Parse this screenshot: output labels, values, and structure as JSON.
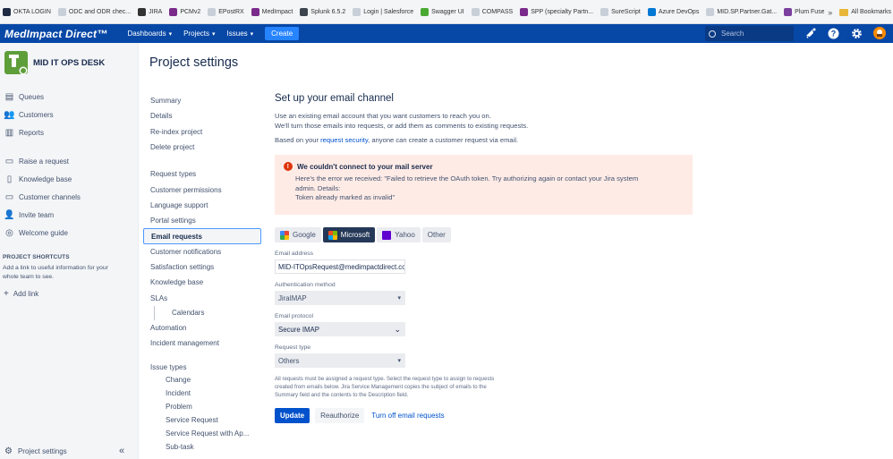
{
  "bookmarks": [
    {
      "label": "OKTA LOGIN",
      "color": "#1f2a44"
    },
    {
      "label": "ODC and ODR chec...",
      "color": "#c9cfd8"
    },
    {
      "label": "JIRA",
      "color": "#333333"
    },
    {
      "label": "PCMv2",
      "color": "#7a2a8a"
    },
    {
      "label": "EPostRX",
      "color": "#c9cfd8"
    },
    {
      "label": "MedImpact",
      "color": "#7a2a8a"
    },
    {
      "label": "Splunk 6.5.2",
      "color": "#3c444d"
    },
    {
      "label": "Login | Salesforce",
      "color": "#c9cfd8"
    },
    {
      "label": "Swagger UI",
      "color": "#49a832"
    },
    {
      "label": "COMPASS",
      "color": "#c9cfd8"
    },
    {
      "label": "SPP (specialty Partn...",
      "color": "#7a2a8a"
    },
    {
      "label": "SureScript",
      "color": "#c9cfd8"
    },
    {
      "label": "Azure DevOps",
      "color": "#0078d4"
    },
    {
      "label": "MID.SP.Partner.Gat...",
      "color": "#c9cfd8"
    },
    {
      "label": "Plum Fuse :: Login",
      "color": "#7b3f9e"
    }
  ],
  "bookmarks_more": "»",
  "bookmarks_all": "All Bookmarks",
  "topnav": {
    "logo": "MedImpact Direct™",
    "dashboards": "Dashboards",
    "projects": "Projects",
    "issues": "Issues",
    "create": "Create",
    "search_placeholder": "Search"
  },
  "sidebar": {
    "project_name": "MID IT OPS DESK",
    "group1": [
      {
        "label": "Queues",
        "icon": "queues-icon"
      },
      {
        "label": "Customers",
        "icon": "customers-icon"
      },
      {
        "label": "Reports",
        "icon": "reports-icon"
      }
    ],
    "group2": [
      {
        "label": "Raise a request",
        "icon": "raise-request-icon"
      },
      {
        "label": "Knowledge base",
        "icon": "knowledge-base-icon"
      },
      {
        "label": "Customer channels",
        "icon": "customer-channels-icon"
      },
      {
        "label": "Invite team",
        "icon": "invite-team-icon"
      },
      {
        "label": "Welcome guide",
        "icon": "welcome-guide-icon"
      }
    ],
    "shortcuts_heading": "PROJECT SHORTCUTS",
    "shortcuts_text": "Add a link to useful information for your whole team to see.",
    "add_link": "Add link",
    "bottom": "Project settings",
    "collapse": "«"
  },
  "page_title": "Project settings",
  "settings_nav": {
    "summary": "Summary",
    "details": "Details",
    "reindex": "Re-index project",
    "delete": "Delete project",
    "request_types": "Request types",
    "customer_permissions": "Customer permissions",
    "language_support": "Language support",
    "portal_settings": "Portal settings",
    "email_requests": "Email requests",
    "customer_notifications": "Customer notifications",
    "satisfaction_settings": "Satisfaction settings",
    "knowledge_base": "Knowledge base",
    "slas": "SLAs",
    "calendars": "Calendars",
    "automation": "Automation",
    "incident_management": "Incident management",
    "issue_types": "Issue types",
    "change": "Change",
    "incident": "Incident",
    "problem": "Problem",
    "service_request": "Service Request",
    "service_request_ap": "Service Request with Ap...",
    "subtask": "Sub-task"
  },
  "content": {
    "heading": "Set up your email channel",
    "intro1": "Use an existing email account that you want customers to reach you on.",
    "intro2": "We'll turn those emails into requests, or add them as comments to existing requests.",
    "based_pre": "Based on your ",
    "based_link": "request security",
    "based_post": ", anyone can create a customer request via email.",
    "error_title": "We couldn't connect to your mail server",
    "error_line1": "Here's the error we received: \"Failed to retrieve the OAuth token. Try authorizing again or contact your Jira system",
    "error_line2": "admin. Details:",
    "error_line3": "Token already marked as invalid\"",
    "providers": {
      "google": "Google",
      "microsoft": "Microsoft",
      "yahoo": "Yahoo",
      "other": "Other"
    },
    "email_label": "Email address",
    "email_value": "MID-ITOpsRequest@medimpactdirect.com",
    "auth_label": "Authentication method",
    "auth_value": "JiraIMAP",
    "protocol_label": "Email protocol",
    "protocol_value": "Secure IMAP",
    "reqtype_label": "Request type",
    "reqtype_value": "Others",
    "help1": "All requests must be assigned a request type. Select the request type to assign to requests",
    "help2": "created from emails below. Jira Service Management copies the subject of emails to the",
    "help3": "Summary field and the contents to the Description field.",
    "update": "Update",
    "reauthorize": "Reauthorize",
    "turn_off": "Turn off email requests"
  }
}
